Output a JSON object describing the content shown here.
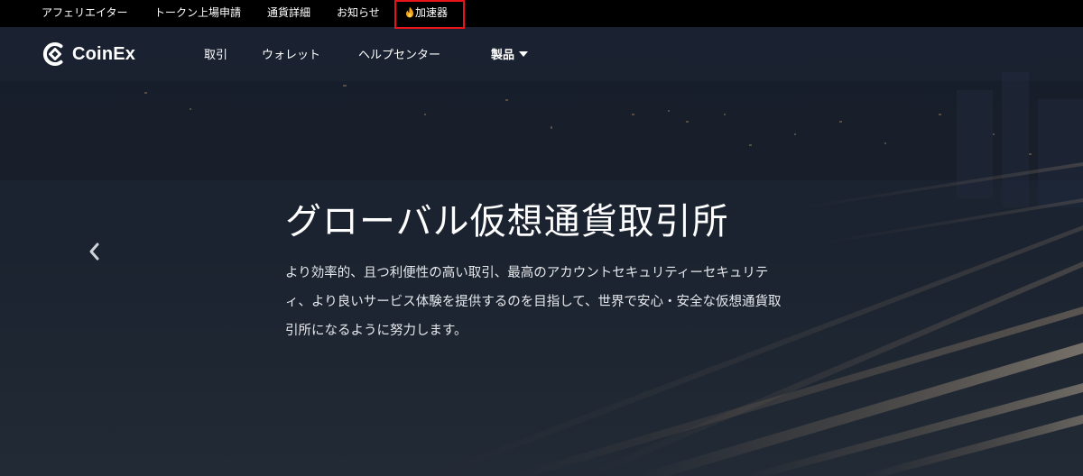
{
  "topbar": {
    "links": [
      {
        "label": "アフェリエイター"
      },
      {
        "label": "トークン上場申請"
      },
      {
        "label": "通貨詳細"
      },
      {
        "label": "お知らせ"
      },
      {
        "label": "加速器",
        "icon": "flame-icon"
      }
    ],
    "highlight_color": "#e8141c"
  },
  "brand": {
    "name": "CoinEx"
  },
  "nav": {
    "items": [
      {
        "label": "取引"
      },
      {
        "label": "ウォレット"
      },
      {
        "label": "ヘルプセンター"
      },
      {
        "label": "製品",
        "icon": "caret-down-icon"
      }
    ]
  },
  "hero": {
    "title": "グローバル仮想通貨取引所",
    "description": "より効率的、且つ利便性の高い取引、最高のアカウントセキュリティーセキュリティ、より良いサービス体験を提供するのを目指して、世界で安心・安全な仮想通貨取引所になるように努力します。",
    "prev_icon": "chevron-left-icon",
    "background": "#1c2331"
  }
}
